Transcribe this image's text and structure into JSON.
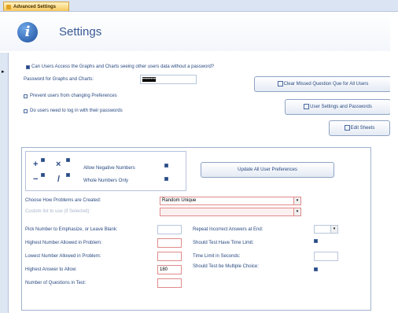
{
  "tab": {
    "title": "Advanced Settings"
  },
  "header": {
    "title": "Settings"
  },
  "record_selector": "▸",
  "top": {
    "access_label": "Can Users Access the Graphs and Charts seeing other users data without a password?",
    "password_label": "Password for Graphs and Charts:",
    "password_value": "••••••••",
    "prevent_label": "Prevent users from changing Preferences",
    "login_label": "Do users need to log in with their passwords",
    "clear_button": "Clear Missed Question Que for All Users",
    "user_settings_button": "User Settings and Passwords",
    "edit_sheets_button": "Edit Sheets"
  },
  "ops": {
    "plus": "+",
    "times": "×",
    "minus": "−",
    "divide": "/",
    "allow_negative_label": "Allow Negative Numbers",
    "whole_numbers_label": "Whole Numbers Only"
  },
  "panel": {
    "update_button": "Update All User Preferences",
    "choose_problems_label": "Choose How Problems are Created:",
    "choose_problems_value": "Random Unique",
    "custom_list_label": "Custom list to use (if Selected):",
    "pick_number_label": "Pick Number to Emphasize, or Leave Blank:",
    "highest_number_label": "Highest Number Allowed in Problem:",
    "lowest_number_label": "Lowest Number Allowed in Problem:",
    "highest_answer_label": "Highest Answer to Allow:",
    "highest_answer_value": "180",
    "num_questions_label": "Number of Questions in Test:",
    "repeat_label": "Repeat Incorrect Answers at End:",
    "no_time_label": "Should Test Have Time Limit:",
    "time_limit_label": "Time Limit in Seconds:",
    "multiple_choice_label": "Should Test be Multiple Choice:"
  }
}
